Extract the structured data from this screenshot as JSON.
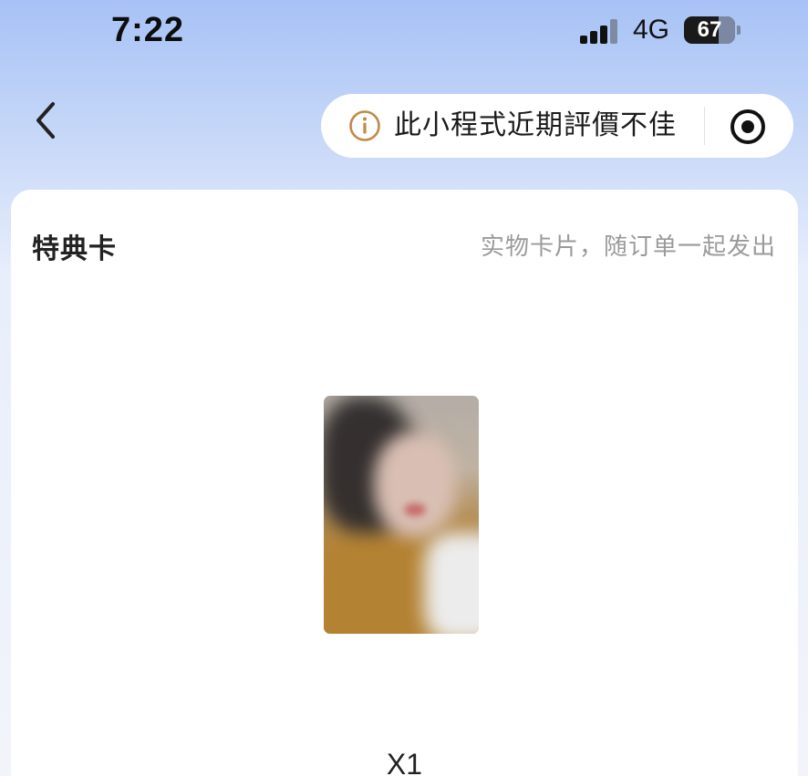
{
  "status_bar": {
    "time": "7:22",
    "network": "4G",
    "battery_level": "67",
    "signal_icon": "signal-bars-icon",
    "battery_icon": "battery-icon"
  },
  "nav": {
    "back_icon": "chevron-left-icon",
    "warning_icon": "info-circle-icon",
    "warning_text": "此小程式近期評價不佳",
    "close_icon": "target-circle-icon",
    "warning_color": "#c08a4a"
  },
  "card": {
    "title": "特典卡",
    "note": "实物卡片，随订单一起发出",
    "image_alt": "photo-card",
    "quantity": "X1"
  }
}
